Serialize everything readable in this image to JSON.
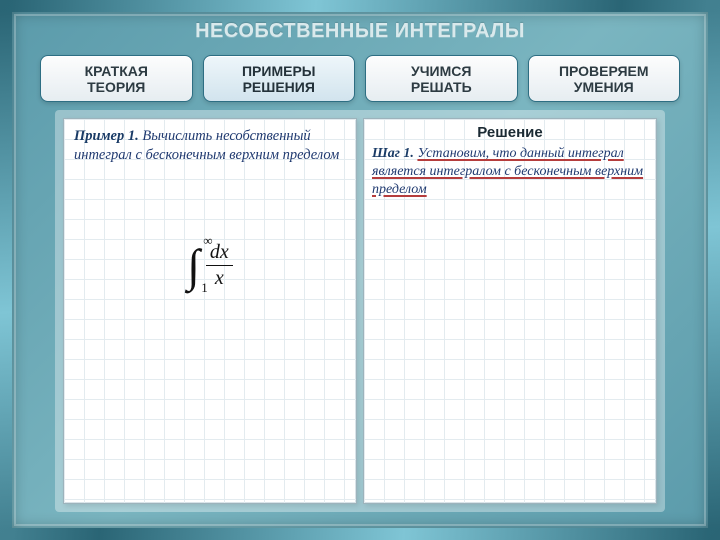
{
  "title": "НЕСОБСТВЕННЫЕ ИНТЕГРАЛЫ",
  "tabs": {
    "theory": "КРАТКАЯ\nТЕОРИЯ",
    "examples": "ПРИМЕРЫ\nРЕШЕНИЯ",
    "learn": "УЧИМСЯ\nРЕШАТЬ",
    "check": "ПРОВЕРЯЕМ\nУМЕНИЯ"
  },
  "problem": {
    "lead": "Пример 1.",
    "task": "Вычислить несобственный интеграл с бесконечным верхним пределом"
  },
  "integral": {
    "symbol": "∫",
    "upper": "∞",
    "lower": "1",
    "num": "dx",
    "den": "x"
  },
  "solution": {
    "heading": "Решение",
    "step_lead": "Шаг 1.",
    "step_link": "Установим, что данный интеграл является интегралом с бесконечным верхним пределом"
  }
}
